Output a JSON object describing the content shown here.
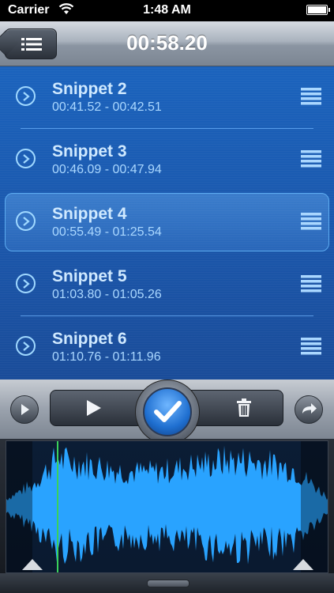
{
  "status_bar": {
    "carrier": "Carrier",
    "time": "1:48 AM"
  },
  "header": {
    "title": "00:58.20",
    "menu_icon": "list-icon"
  },
  "snippets": [
    {
      "name": "Snippet 2",
      "range": "00:41.52 - 00:42.51",
      "selected": false
    },
    {
      "name": "Snippet 3",
      "range": "00:46.09 - 00:47.94",
      "selected": false
    },
    {
      "name": "Snippet 4",
      "range": "00:55.49 - 01:25.54",
      "selected": true
    },
    {
      "name": "Snippet 5",
      "range": "01:03.80 - 01:05.26",
      "selected": false
    },
    {
      "name": "Snippet 6",
      "range": "01:10.76 - 01:11.96",
      "selected": false
    }
  ],
  "controls": {
    "left_icon": "play-circle-icon",
    "play_icon": "play-icon",
    "confirm_icon": "checkmark-icon",
    "delete_icon": "trash-icon",
    "right_icon": "forward-arrow-icon"
  },
  "colors": {
    "list_bg": "#1b5fb5",
    "snippet_text": "#cfe9ff",
    "waveform": "#29a3ff",
    "playhead": "#3bd15a"
  }
}
